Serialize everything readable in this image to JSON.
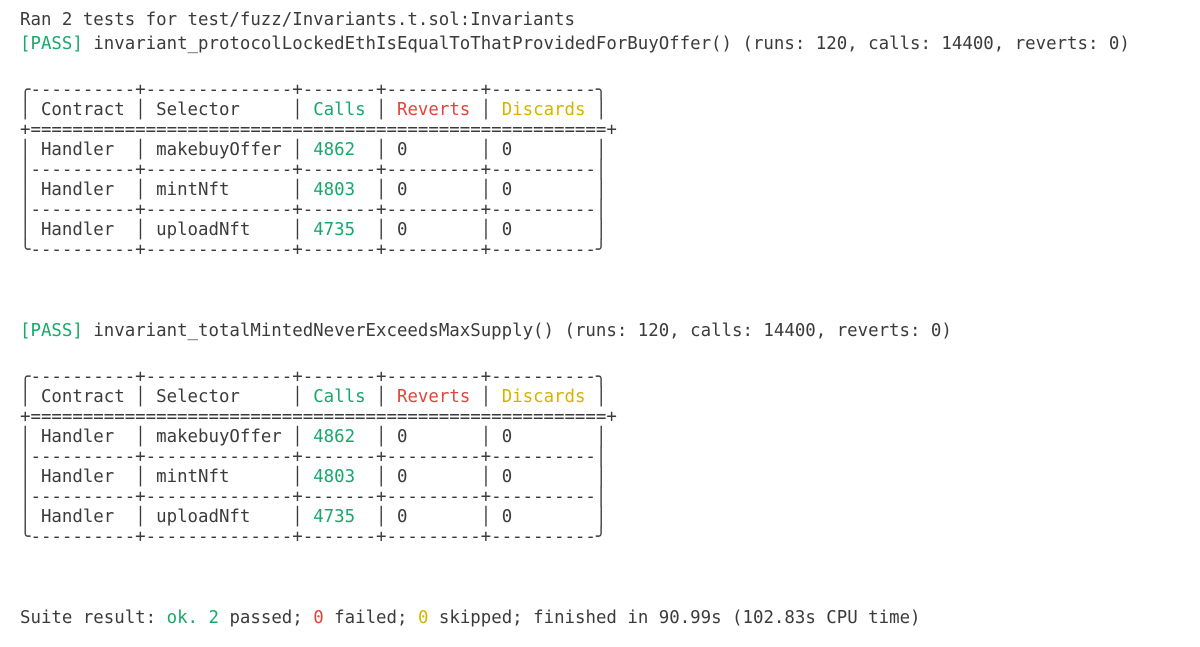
{
  "header": {
    "ran_text": "Ran 2 tests for test/fuzz/Invariants.t.sol:Invariants"
  },
  "tests": [
    {
      "status": "[PASS]",
      "name": "invariant_protocolLockedEthIsEqualToThatProvidedForBuyOffer()",
      "stats": "(runs: 120, calls: 14400, reverts: 0)",
      "table": {
        "headers": {
          "contract": "Contract",
          "selector": "Selector",
          "calls": "Calls",
          "reverts": "Reverts",
          "discards": "Discards"
        },
        "rows": [
          {
            "contract": "Handler",
            "selector": "makebuyOffer",
            "calls": "4862",
            "reverts": "0",
            "discards": "0"
          },
          {
            "contract": "Handler",
            "selector": "mintNft",
            "calls": "4803",
            "reverts": "0",
            "discards": "0"
          },
          {
            "contract": "Handler",
            "selector": "uploadNft",
            "calls": "4735",
            "reverts": "0",
            "discards": "0"
          }
        ]
      }
    },
    {
      "status": "[PASS]",
      "name": "invariant_totalMintedNeverExceedsMaxSupply()",
      "stats": "(runs: 120, calls: 14400, reverts: 0)",
      "table": {
        "headers": {
          "contract": "Contract",
          "selector": "Selector",
          "calls": "Calls",
          "reverts": "Reverts",
          "discards": "Discards"
        },
        "rows": [
          {
            "contract": "Handler",
            "selector": "makebuyOffer",
            "calls": "4862",
            "reverts": "0",
            "discards": "0"
          },
          {
            "contract": "Handler",
            "selector": "mintNft",
            "calls": "4803",
            "reverts": "0",
            "discards": "0"
          },
          {
            "contract": "Handler",
            "selector": "uploadNft",
            "calls": "4735",
            "reverts": "0",
            "discards": "0"
          }
        ]
      }
    }
  ],
  "summary": {
    "prefix": "Suite result: ",
    "ok": "ok.",
    "passed_count": "2",
    "passed_label": " passed; ",
    "failed_count": "0",
    "failed_label": " failed; ",
    "skipped_count": "0",
    "skipped_label": " skipped; ",
    "finished": "finished in 90.99s (102.83s CPU time)"
  },
  "colors": {
    "background": "#ffffff",
    "text": "#3b3b3b",
    "green": "#19a86b",
    "red": "#e0453d",
    "yellow": "#d4b400"
  }
}
